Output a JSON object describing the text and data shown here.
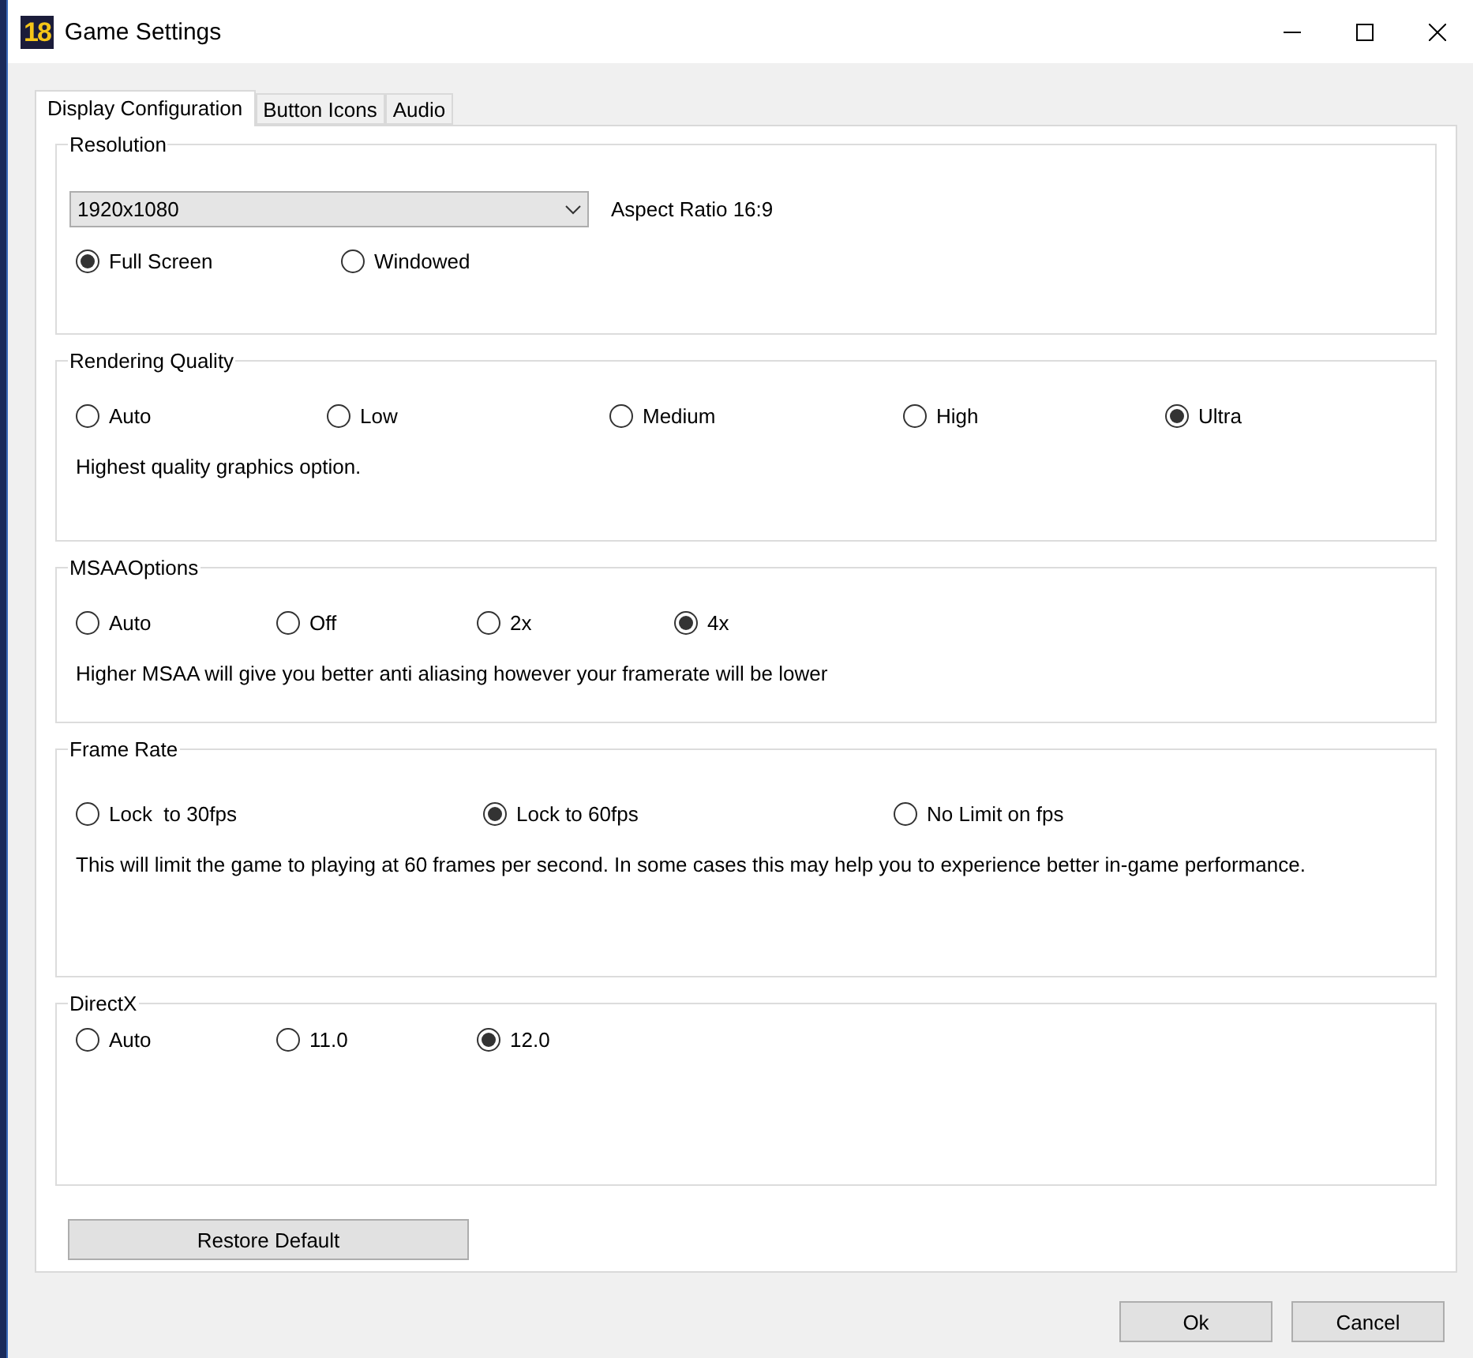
{
  "window": {
    "title": "Game Settings",
    "logo": "18"
  },
  "tabs": [
    {
      "label": "Display Configuration",
      "selected": true
    },
    {
      "label": "Button Icons",
      "selected": false
    },
    {
      "label": "Audio",
      "selected": false
    }
  ],
  "resolution": {
    "title": "Resolution",
    "dropdown": "1920x1080",
    "aspect_ratio": "Aspect Ratio 16:9",
    "options": [
      {
        "label": "Full Screen",
        "selected": true
      },
      {
        "label": "Windowed",
        "selected": false
      }
    ]
  },
  "groups": [
    {
      "title": "Rendering Quality",
      "options": [
        {
          "label": "Auto",
          "selected": false
        },
        {
          "label": "Low",
          "selected": false
        },
        {
          "label": "Medium",
          "selected": false
        },
        {
          "label": "High",
          "selected": false
        },
        {
          "label": "Ultra",
          "selected": true
        }
      ],
      "description": "Highest quality graphics option."
    },
    {
      "title": "MSAAOptions",
      "options": [
        {
          "label": "Auto",
          "selected": false
        },
        {
          "label": "Off",
          "selected": false
        },
        {
          "label": "2x",
          "selected": false
        },
        {
          "label": "4x",
          "selected": true
        }
      ],
      "description": "Higher MSAA will give you better anti aliasing however your framerate will be lower"
    },
    {
      "title": "Frame Rate",
      "options": [
        {
          "label": "Lock  to 30fps",
          "selected": false
        },
        {
          "label": "Lock to 60fps",
          "selected": true
        },
        {
          "label": "No Limit on fps",
          "selected": false
        }
      ],
      "description": "This will limit the game to playing at 60 frames per second. In some cases this may help you to experience better in-game performance."
    },
    {
      "title": "DirectX",
      "options": [
        {
          "label": "Auto",
          "selected": false
        },
        {
          "label": "11.0",
          "selected": false
        },
        {
          "label": "12.0",
          "selected": true
        }
      ]
    }
  ],
  "restore_button": "Restore Default",
  "buttons": [
    "Ok",
    "Cancel"
  ]
}
